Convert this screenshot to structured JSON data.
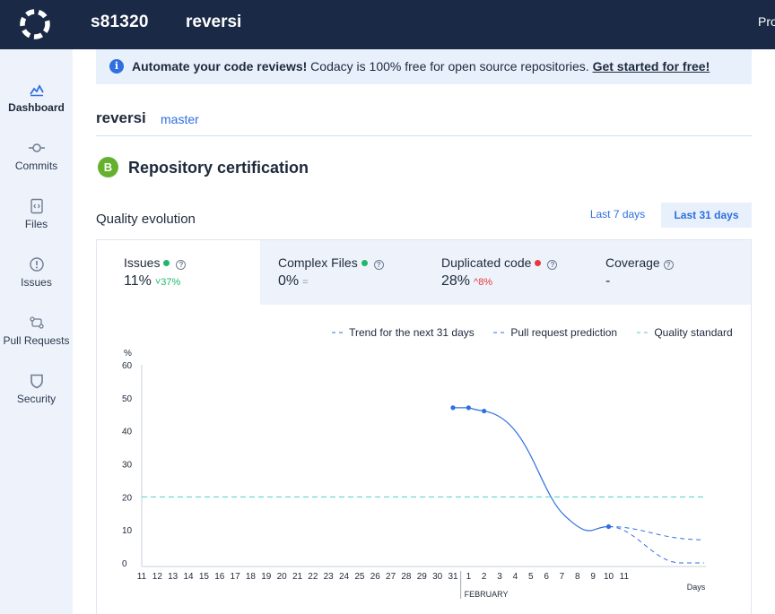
{
  "topbar": {
    "org": "s81320",
    "repo": "reversi",
    "profile_label": "Pro",
    "logo_icon": "codacy-logo-icon"
  },
  "sidebar": {
    "items": [
      {
        "label": "Dashboard",
        "icon": "chart-line-icon",
        "active": true
      },
      {
        "label": "Commits",
        "icon": "commit-icon",
        "active": false
      },
      {
        "label": "Files",
        "icon": "file-code-icon",
        "active": false
      },
      {
        "label": "Issues",
        "icon": "alert-circle-icon",
        "active": false
      },
      {
        "label": "Pull Requests",
        "icon": "pull-request-icon",
        "active": false
      },
      {
        "label": "Security",
        "icon": "shield-icon",
        "active": false
      }
    ]
  },
  "banner": {
    "bold": "Automate your code reviews!",
    "text": " Codacy is 100% free for open source repositories. ",
    "link": "Get started for free!"
  },
  "repo": {
    "name": "reversi",
    "branch": "master"
  },
  "certification": {
    "badge": "B",
    "title": "Repository certification",
    "badge_color": "#65b12d"
  },
  "quality": {
    "title": "Quality evolution",
    "range_7": "Last 7 days",
    "range_31": "Last 31 days",
    "tabs": [
      {
        "label": "Issues",
        "value": "11%",
        "delta": "˅37%",
        "status": "good",
        "delta_color": "#1fb86b"
      },
      {
        "label": "Complex Files",
        "value": "0%",
        "delta": "=",
        "status": "good",
        "delta_color": "#8a96a8"
      },
      {
        "label": "Duplicated code",
        "value": "28%",
        "delta": "^8%",
        "status": "bad",
        "delta_color": "#e8383d"
      },
      {
        "label": "Coverage",
        "value": "-",
        "delta": "",
        "status": "none",
        "delta_color": "#8a96a8"
      }
    ],
    "legend": {
      "trend": "Trend for the next 31 days",
      "prediction": "Pull request prediction",
      "standard": "Quality standard"
    }
  },
  "chart_data": {
    "type": "line",
    "ylabel": "%",
    "xlabel": "Days",
    "ylim": [
      0,
      60
    ],
    "yticks": [
      0,
      10,
      20,
      30,
      40,
      50,
      60
    ],
    "x_ticks": [
      "11",
      "12",
      "13",
      "14",
      "15",
      "16",
      "17",
      "18",
      "19",
      "20",
      "21",
      "22",
      "23",
      "24",
      "25",
      "26",
      "27",
      "28",
      "29",
      "30",
      "31",
      "1",
      "2",
      "3",
      "4",
      "5",
      "6",
      "7",
      "8",
      "9",
      "10",
      "11"
    ],
    "month_label": "FEBRUARY",
    "series": [
      {
        "values": [
          {
            "x": "31",
            "y": 47
          },
          {
            "x": "1",
            "y": 47
          },
          {
            "x": "2",
            "y": 46
          },
          {
            "x": "10",
            "y": 11
          }
        ],
        "color": "#2f6fdf"
      },
      {
        "name": "Trend for the next 31 days",
        "values": [
          {
            "x": "10",
            "y": 11
          },
          {
            "x": "Days",
            "y": 7
          }
        ],
        "color": "#2f6fdf",
        "dashed": true
      },
      {
        "name": "Pull request prediction",
        "values": [
          {
            "x": "10",
            "y": 11
          },
          {
            "x": "Days",
            "y": 0
          }
        ],
        "color": "#2f6fdf",
        "dashed": true
      },
      {
        "name": "Quality standard",
        "values": [
          {
            "x": "11",
            "y": 20
          },
          {
            "x": "Days",
            "y": 20
          }
        ],
        "color": "#4fd1c5",
        "dashed": true
      }
    ]
  },
  "colors": {
    "good": "#1fb86b",
    "bad": "#e8383d",
    "accent": "#2f6fdf",
    "standard": "#4fd1c5",
    "topbar": "#1a2945"
  }
}
